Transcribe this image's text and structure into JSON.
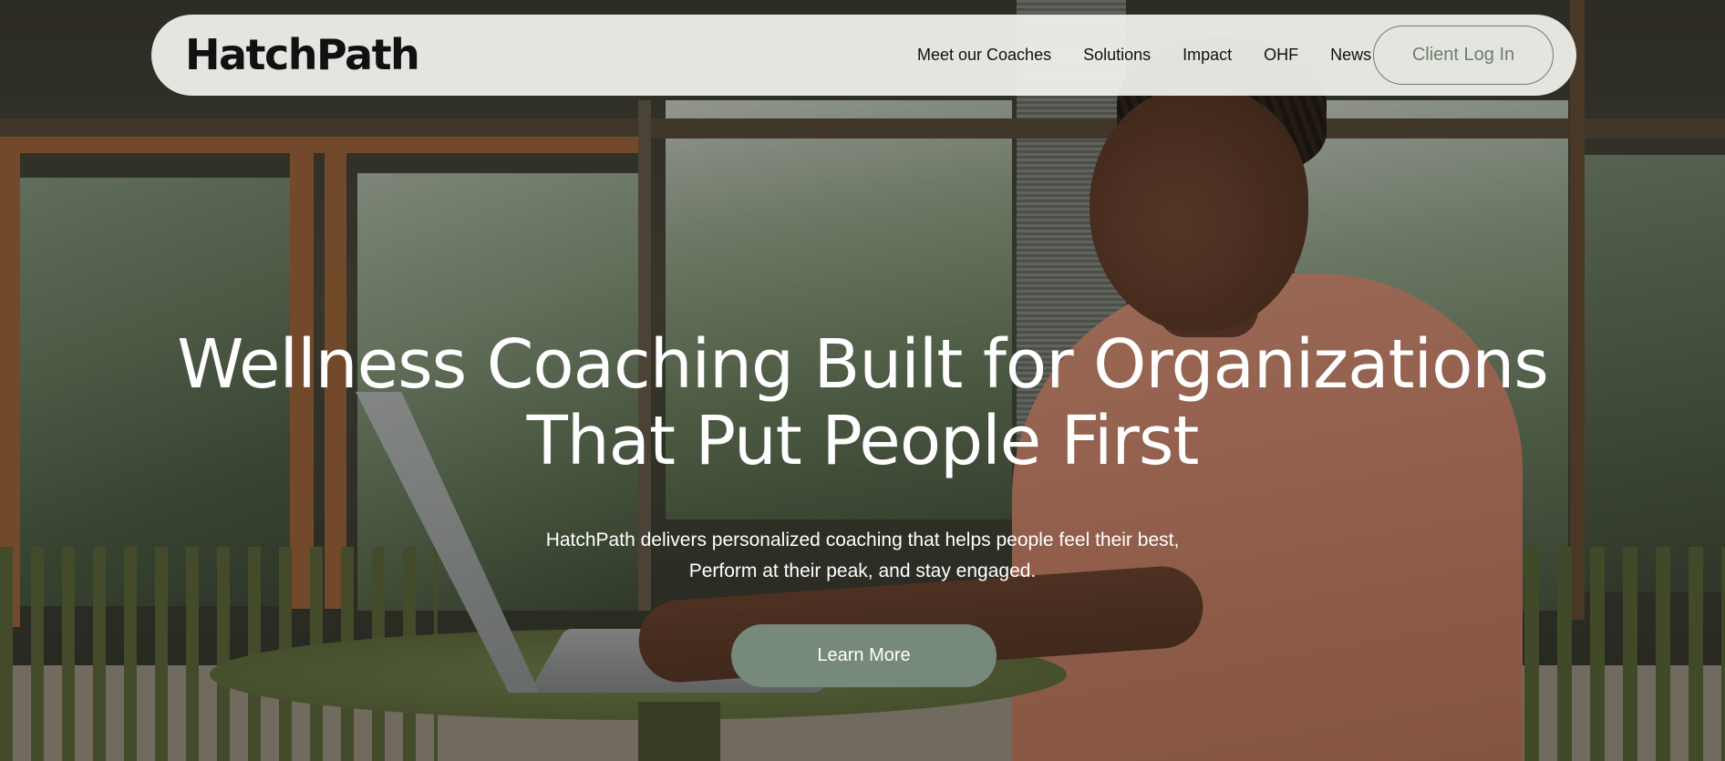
{
  "brand": {
    "name": "HatchPath",
    "accent_color": "#77897a",
    "nav_bg": "#f4f4f0"
  },
  "nav": {
    "links": [
      "Meet our Coaches",
      "Solutions",
      "Impact",
      "OHF",
      "News"
    ],
    "login_label": "Client Log In"
  },
  "hero": {
    "title_line1": "Wellness Coaching Built for Organizations",
    "title_line2": "That Put People First",
    "subtitle_line1": "HatchPath delivers personalized coaching that helps people feel their best,",
    "subtitle_line2": "Perform at their peak, and stay engaged.",
    "cta_label": "Learn More"
  }
}
